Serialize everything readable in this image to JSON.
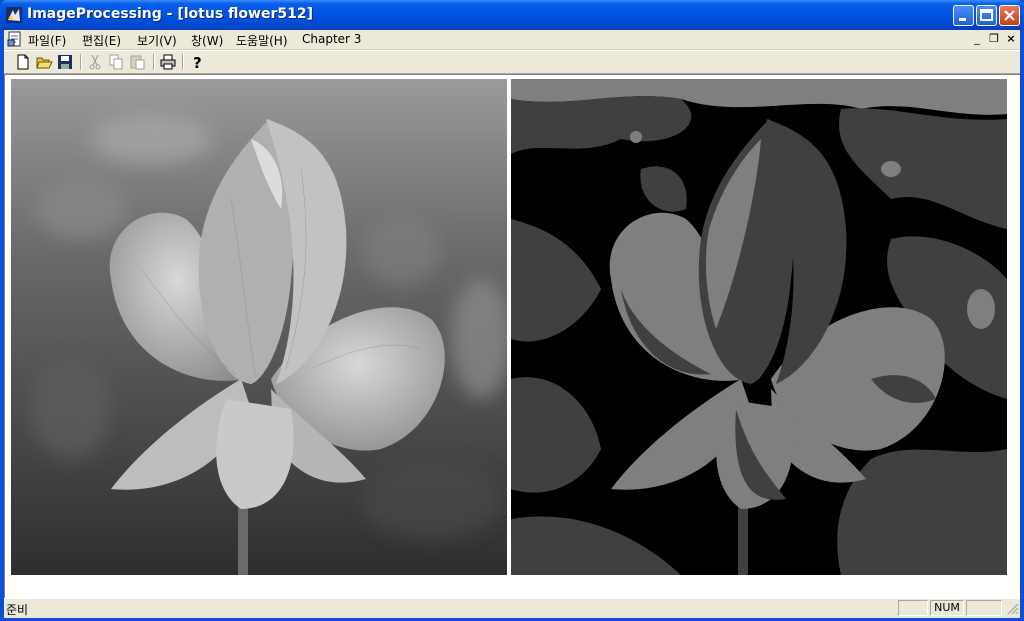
{
  "window": {
    "title": "ImageProcessing - [lotus flower512]"
  },
  "menu": {
    "items": [
      "파일(F)",
      "편집(E)",
      "보기(V)",
      "창(W)",
      "도움말(H)",
      "Chapter 3"
    ]
  },
  "mdi_controls": {
    "minimize": "_",
    "restore": "❐",
    "close": "×"
  },
  "toolbar": {
    "icons": [
      "new-file-icon",
      "open-folder-icon",
      "save-icon",
      "cut-icon",
      "copy-icon",
      "paste-icon",
      "print-icon",
      "help-icon"
    ]
  },
  "images": {
    "left": "original-lotus-image",
    "right": "posterized-lotus-image"
  },
  "statusbar": {
    "text": "준비",
    "num_indicator": "NUM"
  },
  "colors": {
    "titlebar": "#0054E3",
    "close_button": "#C73F1A",
    "face": "#ECE9D8"
  }
}
